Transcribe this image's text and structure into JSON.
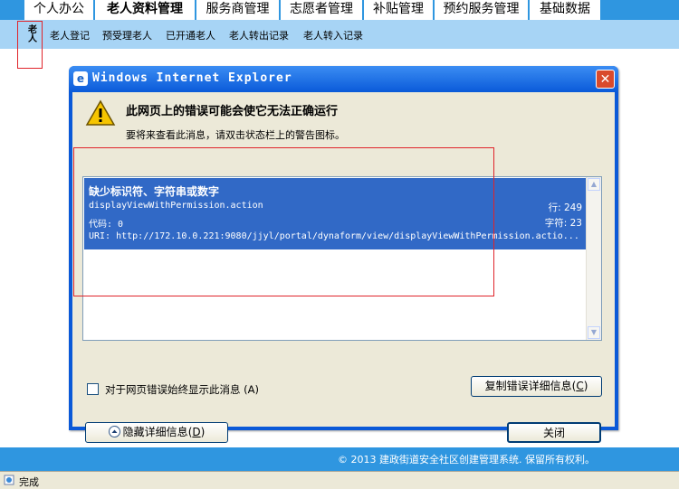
{
  "top_tabs": [
    {
      "label": "个人办公"
    },
    {
      "label": "老人资料管理",
      "active": true
    },
    {
      "label": "服务商管理"
    },
    {
      "label": "志愿者管理"
    },
    {
      "label": "补贴管理"
    },
    {
      "label": "预约服务管理"
    },
    {
      "label": "基础数据"
    }
  ],
  "subnav": {
    "first_item": "老人",
    "items": [
      "老人登记",
      "预受理老人",
      "已开通老人",
      "老人转出记录",
      "老人转入记录"
    ]
  },
  "dialog": {
    "title": "Windows Internet Explorer",
    "close_glyph": "✕",
    "icon_glyph": "e",
    "main_message": "此网页上的错误可能会使它无法正确运行",
    "sub_message": "要将来查看此消息，请双击状态栏上的警告图标。",
    "error": {
      "heading": "缺少标识符、字符串或数字",
      "function": "displayViewWithPermission.action",
      "line_label": "行: 249",
      "code_label": "代码: 0",
      "char_label": "字符: 23",
      "uri_label": "URI: http://172.10.0.221:9080/jjyl/portal/dynaform/view/displayViewWithPermission.actio..."
    },
    "checkbox_label": "对于网页错误始终显示此消息",
    "checkbox_shortcut": "(A)",
    "copy_button": "复制错误详细信息",
    "copy_shortcut": "C",
    "hide_button": "隐藏详细信息",
    "hide_shortcut": "D",
    "close_button": "关闭"
  },
  "footer": {
    "copyright": "© 2013 建政街道安全社区创建管理系统. 保留所有权利。"
  },
  "statusbar": {
    "text": "完成"
  },
  "colors": {
    "accent_blue": "#2f96e0",
    "subnav_bg": "#a7d4f5",
    "selection_blue": "#3169c6",
    "highlight_red": "#e0242a"
  }
}
